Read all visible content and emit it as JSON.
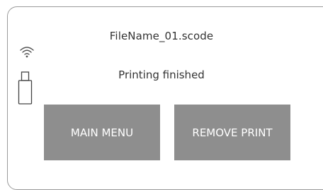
{
  "file": {
    "name": "FileName_01.scode"
  },
  "status": {
    "text": "Printing finished"
  },
  "indicators": {
    "wifi_icon": "wifi-icon",
    "usb_icon": "usb-drive-icon"
  },
  "buttons": {
    "main_menu": "MAIN MENU",
    "remove_print": "REMOVE PRINT"
  },
  "colors": {
    "button_bg": "#8e8e8e",
    "button_text": "#ffffff",
    "text": "#333333",
    "border": "#9a9a9a"
  }
}
